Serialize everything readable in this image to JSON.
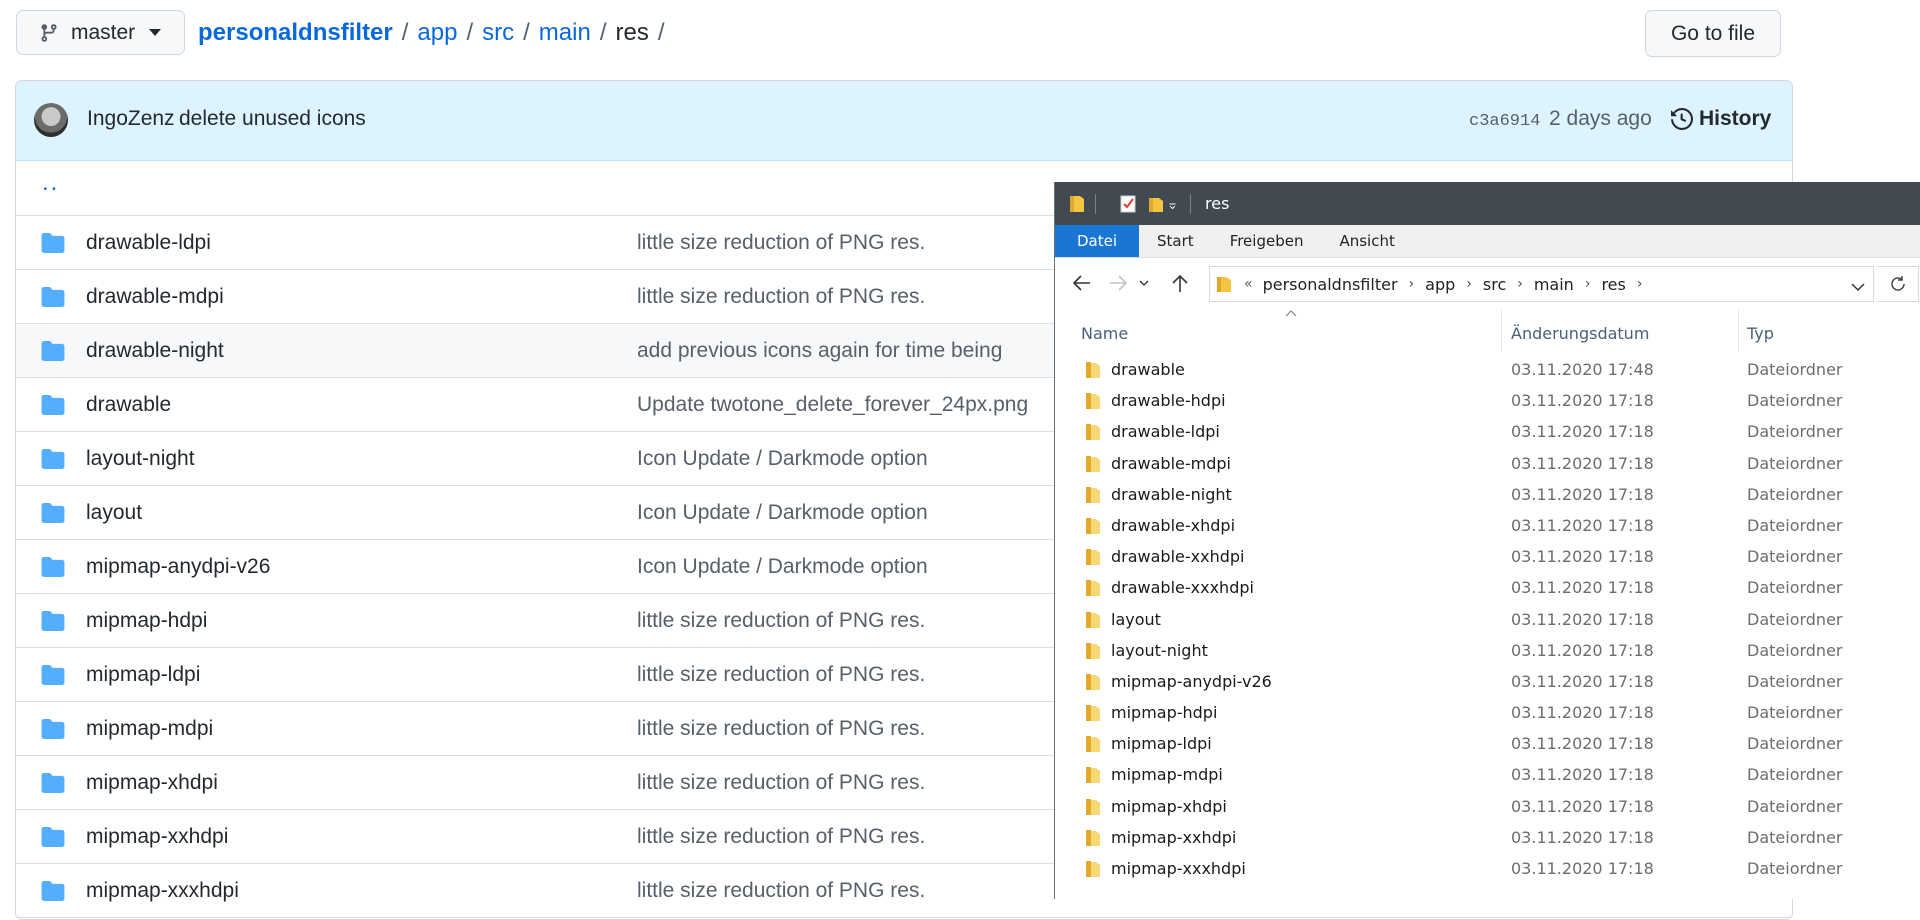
{
  "github": {
    "branch": "master",
    "breadcrumb": {
      "repo": "personaldnsfilter",
      "dirs": [
        "app",
        "src",
        "main"
      ],
      "current": "res",
      "separator": "/"
    },
    "goto_label": "Go to file",
    "commit": {
      "author": "IngoZenz",
      "message": "delete unused icons",
      "sha": "c3a6914",
      "age": "2 days ago",
      "history_label": "History"
    },
    "parent_link": "..",
    "files": [
      {
        "name": "drawable-ldpi",
        "message": "little size reduction of PNG res."
      },
      {
        "name": "drawable-mdpi",
        "message": "little size reduction of PNG res."
      },
      {
        "name": "drawable-night",
        "message": "add previous icons again for time being"
      },
      {
        "name": "drawable",
        "message": "Update twotone_delete_forever_24px.png"
      },
      {
        "name": "layout-night",
        "message": "Icon Update / Darkmode option"
      },
      {
        "name": "layout",
        "message": "Icon Update / Darkmode option"
      },
      {
        "name": "mipmap-anydpi-v26",
        "message": "Icon Update / Darkmode option"
      },
      {
        "name": "mipmap-hdpi",
        "message": "little size reduction of PNG res."
      },
      {
        "name": "mipmap-ldpi",
        "message": "little size reduction of PNG res."
      },
      {
        "name": "mipmap-mdpi",
        "message": "little size reduction of PNG res."
      },
      {
        "name": "mipmap-xhdpi",
        "message": "little size reduction of PNG res."
      },
      {
        "name": "mipmap-xxhdpi",
        "message": "little size reduction of PNG res."
      },
      {
        "name": "mipmap-xxxhdpi",
        "message": "little size reduction of PNG res."
      }
    ],
    "colors": {
      "link": "#0969da",
      "folder": "#54aeff",
      "commit_bar": "#ddf4ff"
    }
  },
  "explorer": {
    "title": "res",
    "tabs": [
      "Datei",
      "Start",
      "Freigeben",
      "Ansicht"
    ],
    "active_tab": "Datei",
    "address": {
      "overflow_symbol": "«",
      "parts": [
        "personaldnsfilter",
        "app",
        "src",
        "main",
        "res"
      ]
    },
    "columns": {
      "name": "Name",
      "date": "Änderungsdatum",
      "type": "Typ"
    },
    "rows": [
      {
        "name": "drawable",
        "date": "03.11.2020 17:48",
        "type": "Dateiordner"
      },
      {
        "name": "drawable-hdpi",
        "date": "03.11.2020 17:18",
        "type": "Dateiordner"
      },
      {
        "name": "drawable-ldpi",
        "date": "03.11.2020 17:18",
        "type": "Dateiordner"
      },
      {
        "name": "drawable-mdpi",
        "date": "03.11.2020 17:18",
        "type": "Dateiordner"
      },
      {
        "name": "drawable-night",
        "date": "03.11.2020 17:18",
        "type": "Dateiordner"
      },
      {
        "name": "drawable-xhdpi",
        "date": "03.11.2020 17:18",
        "type": "Dateiordner"
      },
      {
        "name": "drawable-xxhdpi",
        "date": "03.11.2020 17:18",
        "type": "Dateiordner"
      },
      {
        "name": "drawable-xxxhdpi",
        "date": "03.11.2020 17:18",
        "type": "Dateiordner"
      },
      {
        "name": "layout",
        "date": "03.11.2020 17:18",
        "type": "Dateiordner"
      },
      {
        "name": "layout-night",
        "date": "03.11.2020 17:18",
        "type": "Dateiordner"
      },
      {
        "name": "mipmap-anydpi-v26",
        "date": "03.11.2020 17:18",
        "type": "Dateiordner"
      },
      {
        "name": "mipmap-hdpi",
        "date": "03.11.2020 17:18",
        "type": "Dateiordner"
      },
      {
        "name": "mipmap-ldpi",
        "date": "03.11.2020 17:18",
        "type": "Dateiordner"
      },
      {
        "name": "mipmap-mdpi",
        "date": "03.11.2020 17:18",
        "type": "Dateiordner"
      },
      {
        "name": "mipmap-xhdpi",
        "date": "03.11.2020 17:18",
        "type": "Dateiordner"
      },
      {
        "name": "mipmap-xxhdpi",
        "date": "03.11.2020 17:18",
        "type": "Dateiordner"
      },
      {
        "name": "mipmap-xxxhdpi",
        "date": "03.11.2020 17:18",
        "type": "Dateiordner"
      }
    ],
    "colors": {
      "title_bar": "#404a50",
      "active_tab": "#1976d2",
      "folder": "#f5c542"
    }
  }
}
